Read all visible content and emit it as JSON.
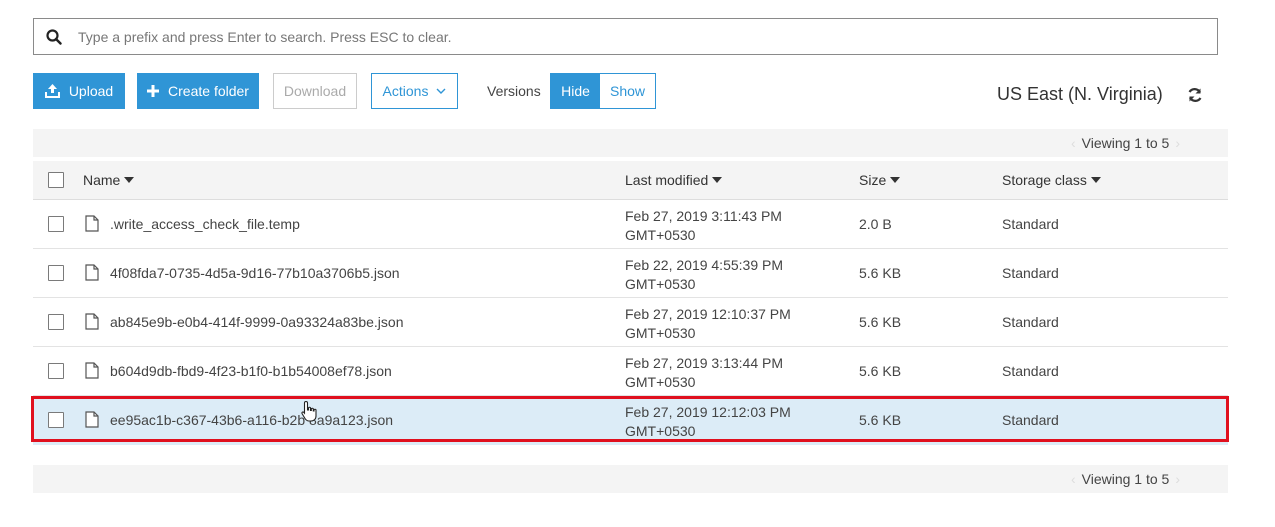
{
  "search": {
    "placeholder": "Type a prefix and press Enter to search. Press ESC to clear."
  },
  "toolbar": {
    "upload": "Upload",
    "create_folder": "Create folder",
    "download": "Download",
    "actions": "Actions",
    "versions_label": "Versions",
    "versions_hide": "Hide",
    "versions_show": "Show"
  },
  "region": "US East (N. Virginia)",
  "viewing": {
    "top": "Viewing 1 to 5",
    "bottom": "Viewing 1 to 5"
  },
  "table": {
    "columns": {
      "name": "Name",
      "last_modified": "Last modified",
      "size": "Size",
      "storage_class": "Storage class"
    },
    "rows": [
      {
        "name": ".write_access_check_file.temp",
        "modified_date": "Feb 27, 2019 3:11:43 PM",
        "modified_tz": "GMT+0530",
        "size": "2.0 B",
        "storage_class": "Standard"
      },
      {
        "name": "4f08fda7-0735-4d5a-9d16-77b10a3706b5.json",
        "modified_date": "Feb 22, 2019 4:55:39 PM",
        "modified_tz": "GMT+0530",
        "size": "5.6 KB",
        "storage_class": "Standard"
      },
      {
        "name": "ab845e9b-e0b4-414f-9999-0a93324a83be.json",
        "modified_date": "Feb 27, 2019 12:10:37 PM",
        "modified_tz": "GMT+0530",
        "size": "5.6 KB",
        "storage_class": "Standard"
      },
      {
        "name": "b604d9db-fbd9-4f23-b1f0-b1b54008ef78.json",
        "modified_date": "Feb 27, 2019 3:13:44 PM",
        "modified_tz": "GMT+0530",
        "size": "5.6 KB",
        "storage_class": "Standard"
      },
      {
        "name": "ee95ac1b-c367-43b6-a116-b2b 8a9a123.json",
        "modified_date": "Feb 27, 2019 12:12:03 PM",
        "modified_tz": "GMT+0530",
        "size": "5.6 KB",
        "storage_class": "Standard"
      }
    ]
  },
  "colors": {
    "accent": "#2f95d6",
    "selected_row": "#dcecf7",
    "highlight": "#e0101e"
  }
}
